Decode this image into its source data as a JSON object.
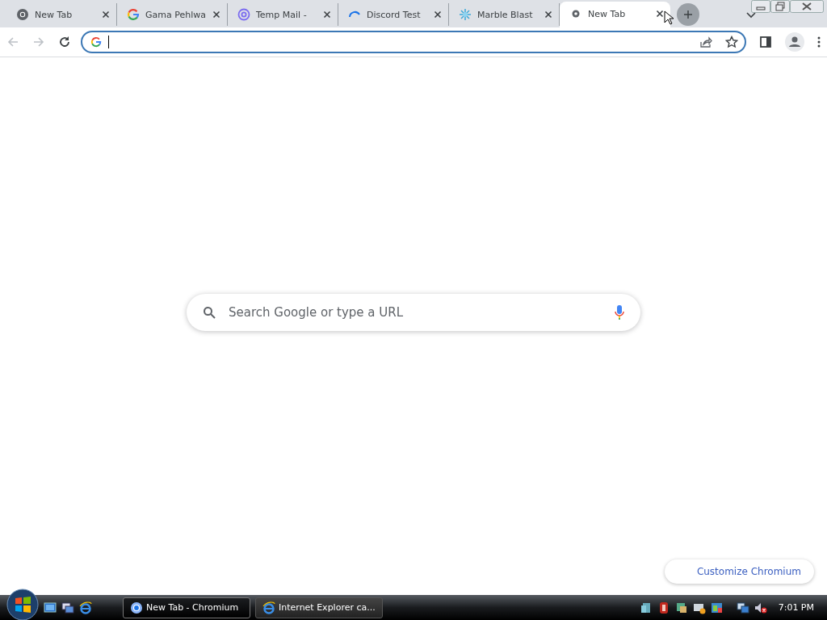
{
  "tabs": [
    {
      "title": "New Tab",
      "kind": "chromium",
      "selected": false
    },
    {
      "title": "Gama Pehlwa",
      "kind": "google",
      "selected": false
    },
    {
      "title": "Temp Mail -",
      "kind": "at",
      "selected": false
    },
    {
      "title": "Discord Test",
      "kind": "loading",
      "selected": false
    },
    {
      "title": "Marble Blast",
      "kind": "sparkle",
      "selected": false
    },
    {
      "title": "New Tab",
      "kind": "newtab",
      "selected": true
    }
  ],
  "search_box": {
    "placeholder": "Search Google or type a URL"
  },
  "customize_button": "Customize Chromium",
  "taskbar": {
    "tasks": [
      {
        "label": "New Tab - Chromium",
        "kind": "chromium",
        "selected": true
      },
      {
        "label": "Internet Explorer ca...",
        "kind": "ie",
        "selected": false
      }
    ],
    "clock": "7:01 PM"
  }
}
